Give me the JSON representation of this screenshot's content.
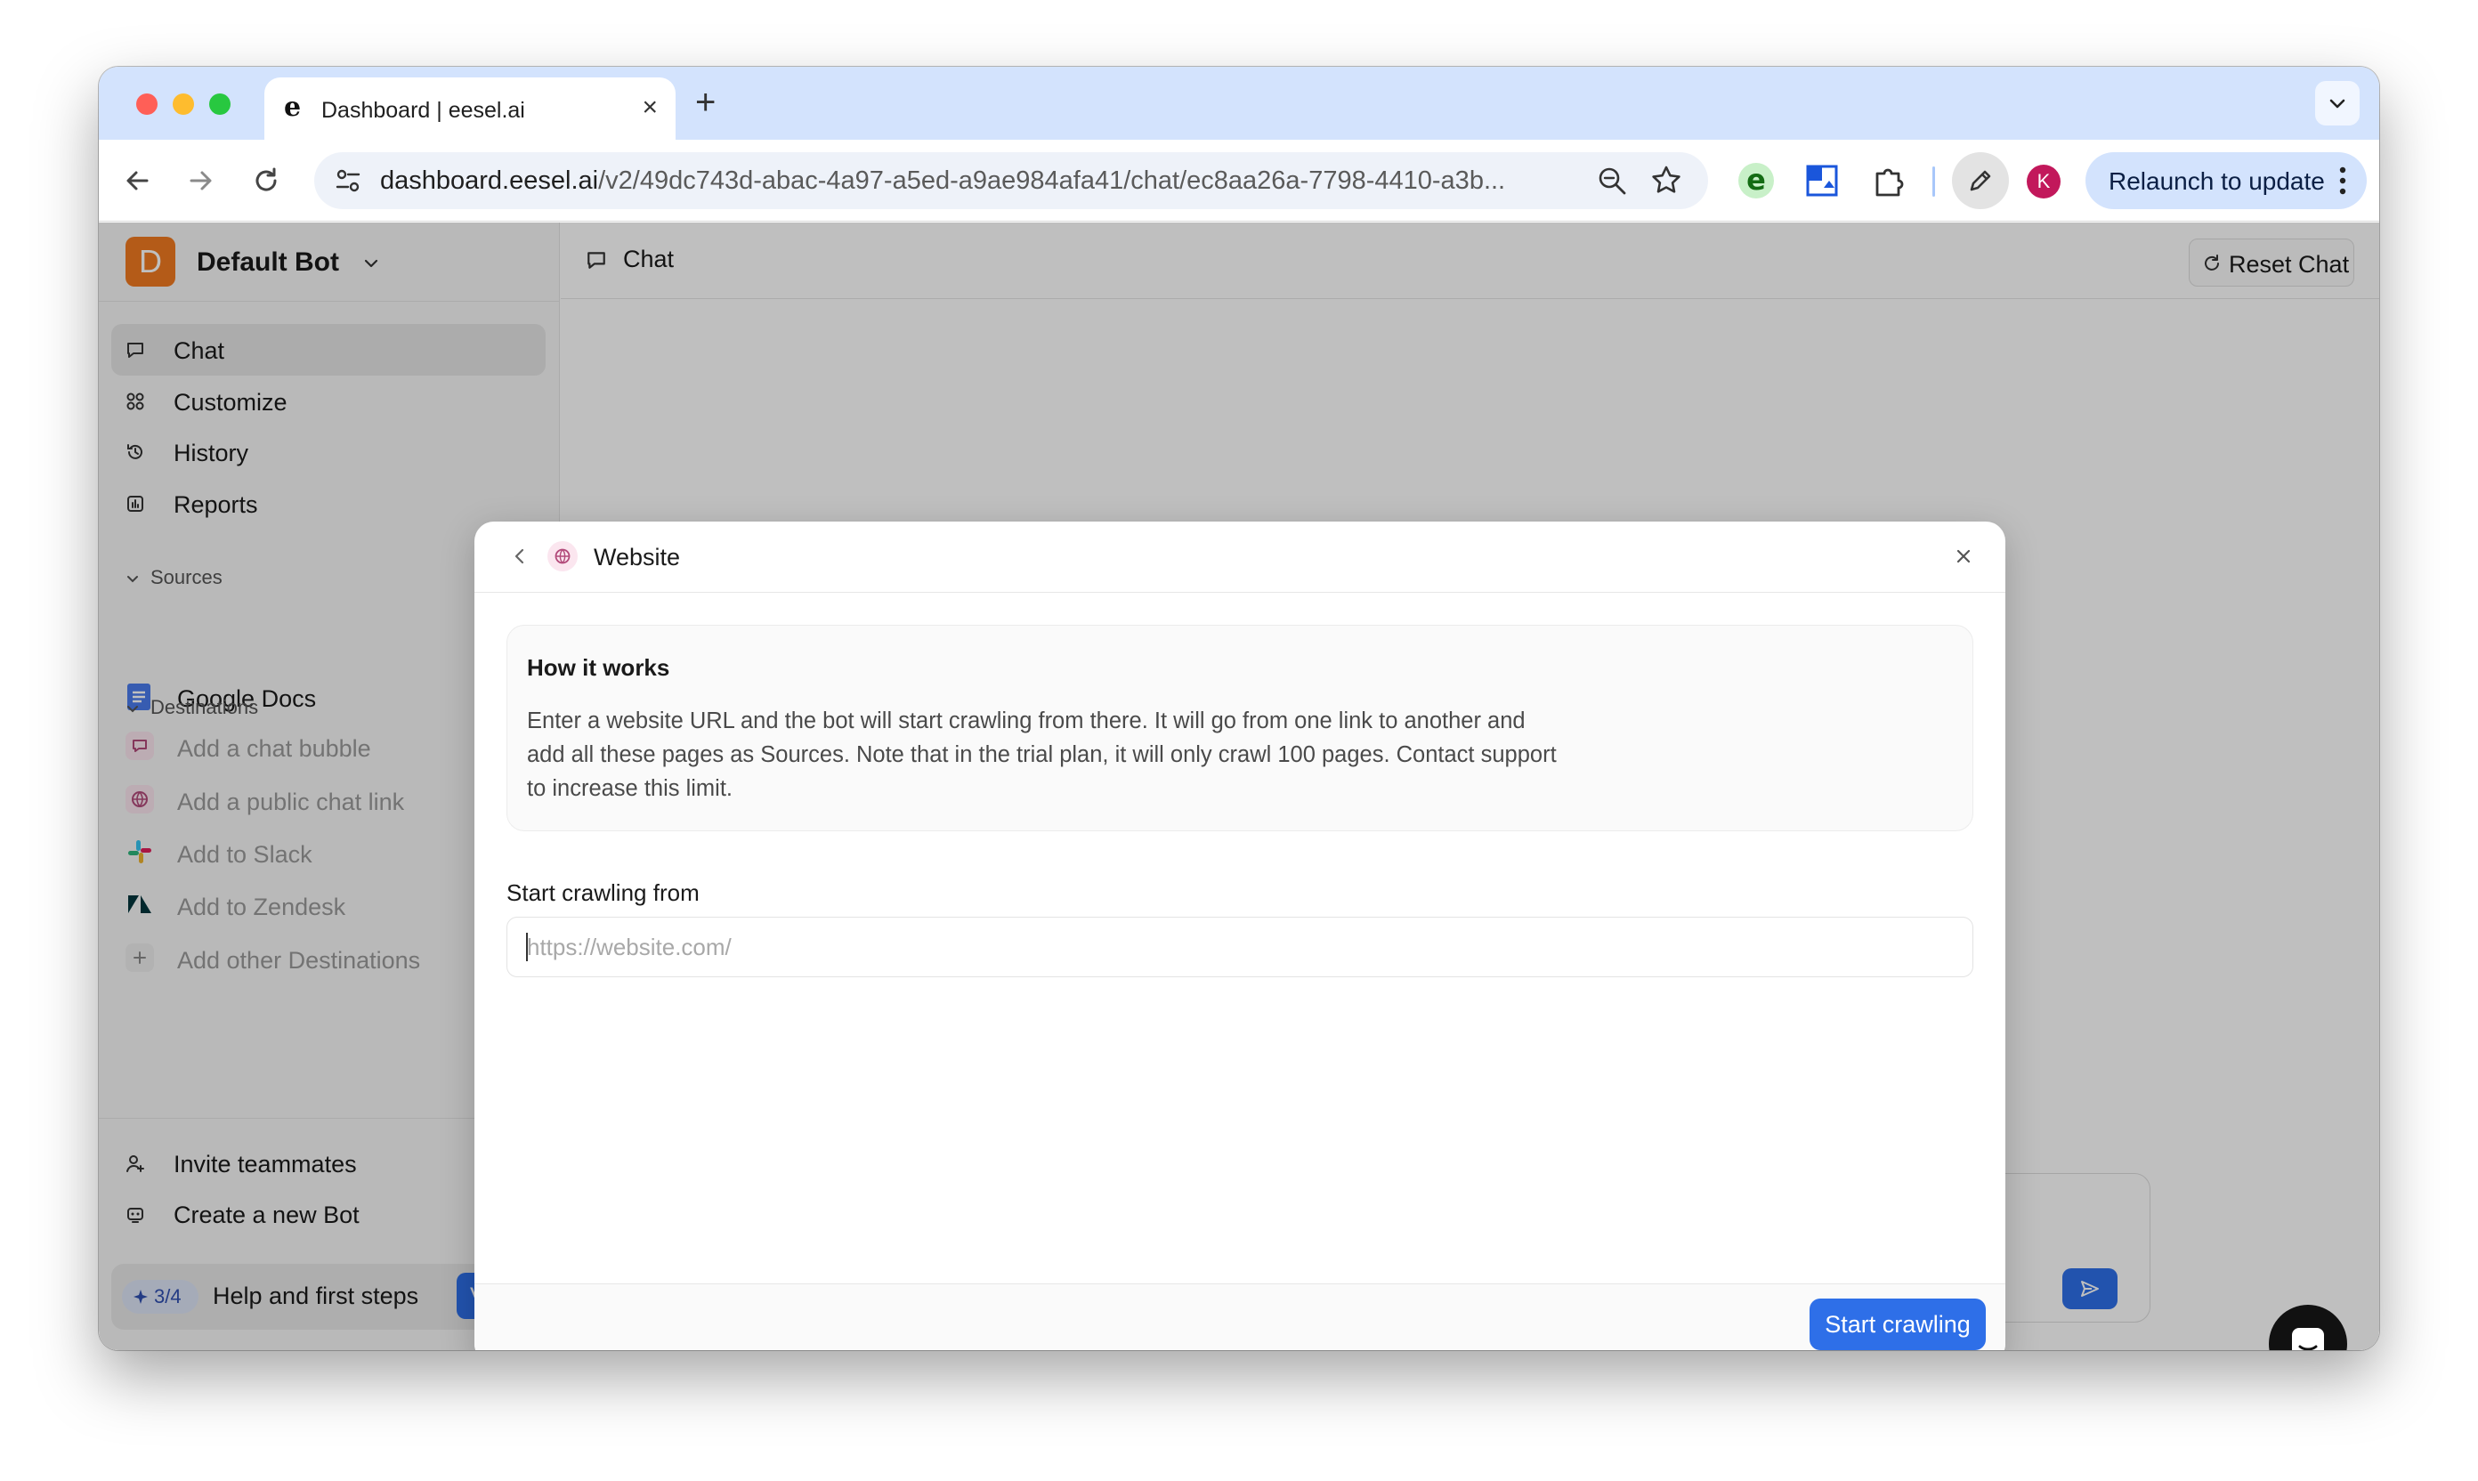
{
  "browser": {
    "tab_title": "Dashboard | eesel.ai",
    "tab_favicon": "e",
    "url_host": "dashboard.eesel.ai",
    "url_path": "/v2/49dc743d-abac-4a97-a5ed-a9ae984afa41/chat/ec8aa26a-7798-4410-a3b...",
    "profile_initial": "K",
    "extension_letter": "e",
    "relaunch_label": "Relaunch to update"
  },
  "sidebar": {
    "bot_initial": "D",
    "bot_name": "Default Bot",
    "nav": [
      {
        "label": "Chat",
        "icon": "chat-bubble-icon",
        "active": true
      },
      {
        "label": "Customize",
        "icon": "grid-icon"
      },
      {
        "label": "History",
        "icon": "history-icon"
      },
      {
        "label": "Reports",
        "icon": "reports-icon"
      }
    ],
    "sources_heading": "Sources",
    "sources": [
      {
        "label": "Google Docs",
        "icon": "google-docs-icon",
        "color": "#4a7bec"
      }
    ],
    "destinations_heading": "Destinations",
    "destinations": [
      {
        "label": "Add a chat bubble",
        "icon": "chat-bubble-icon"
      },
      {
        "label": "Add a public chat link",
        "icon": "globe-icon"
      },
      {
        "label": "Add to Slack",
        "icon": "slack-icon"
      },
      {
        "label": "Add to Zendesk",
        "icon": "zendesk-icon"
      },
      {
        "label": "Add other Destinations",
        "icon": "plus-icon"
      }
    ],
    "footer": [
      {
        "label": "Invite teammates",
        "icon": "user-plus-icon"
      },
      {
        "label": "Create a new Bot",
        "icon": "bot-icon"
      }
    ],
    "help": {
      "badge": "3/4",
      "label": "Help and first steps",
      "button": "View"
    }
  },
  "main": {
    "header_title": "Chat",
    "reset_label": "Reset Chat"
  },
  "modal": {
    "title": "Website",
    "info_title": "How it works",
    "info_text": "Enter a website URL and the bot will start crawling from there. It will go from one link to another and add all these pages as Sources. Note that in the trial plan, it will only crawl 100 pages. Contact support to increase this limit.",
    "field_label": "Start crawling from",
    "input_value": "",
    "input_placeholder": "https://website.com/",
    "submit_label": "Start crawling"
  },
  "colors": {
    "accent": "#2e6fe8",
    "bot_avatar": "#f07a20",
    "profile": "#c2185b"
  }
}
